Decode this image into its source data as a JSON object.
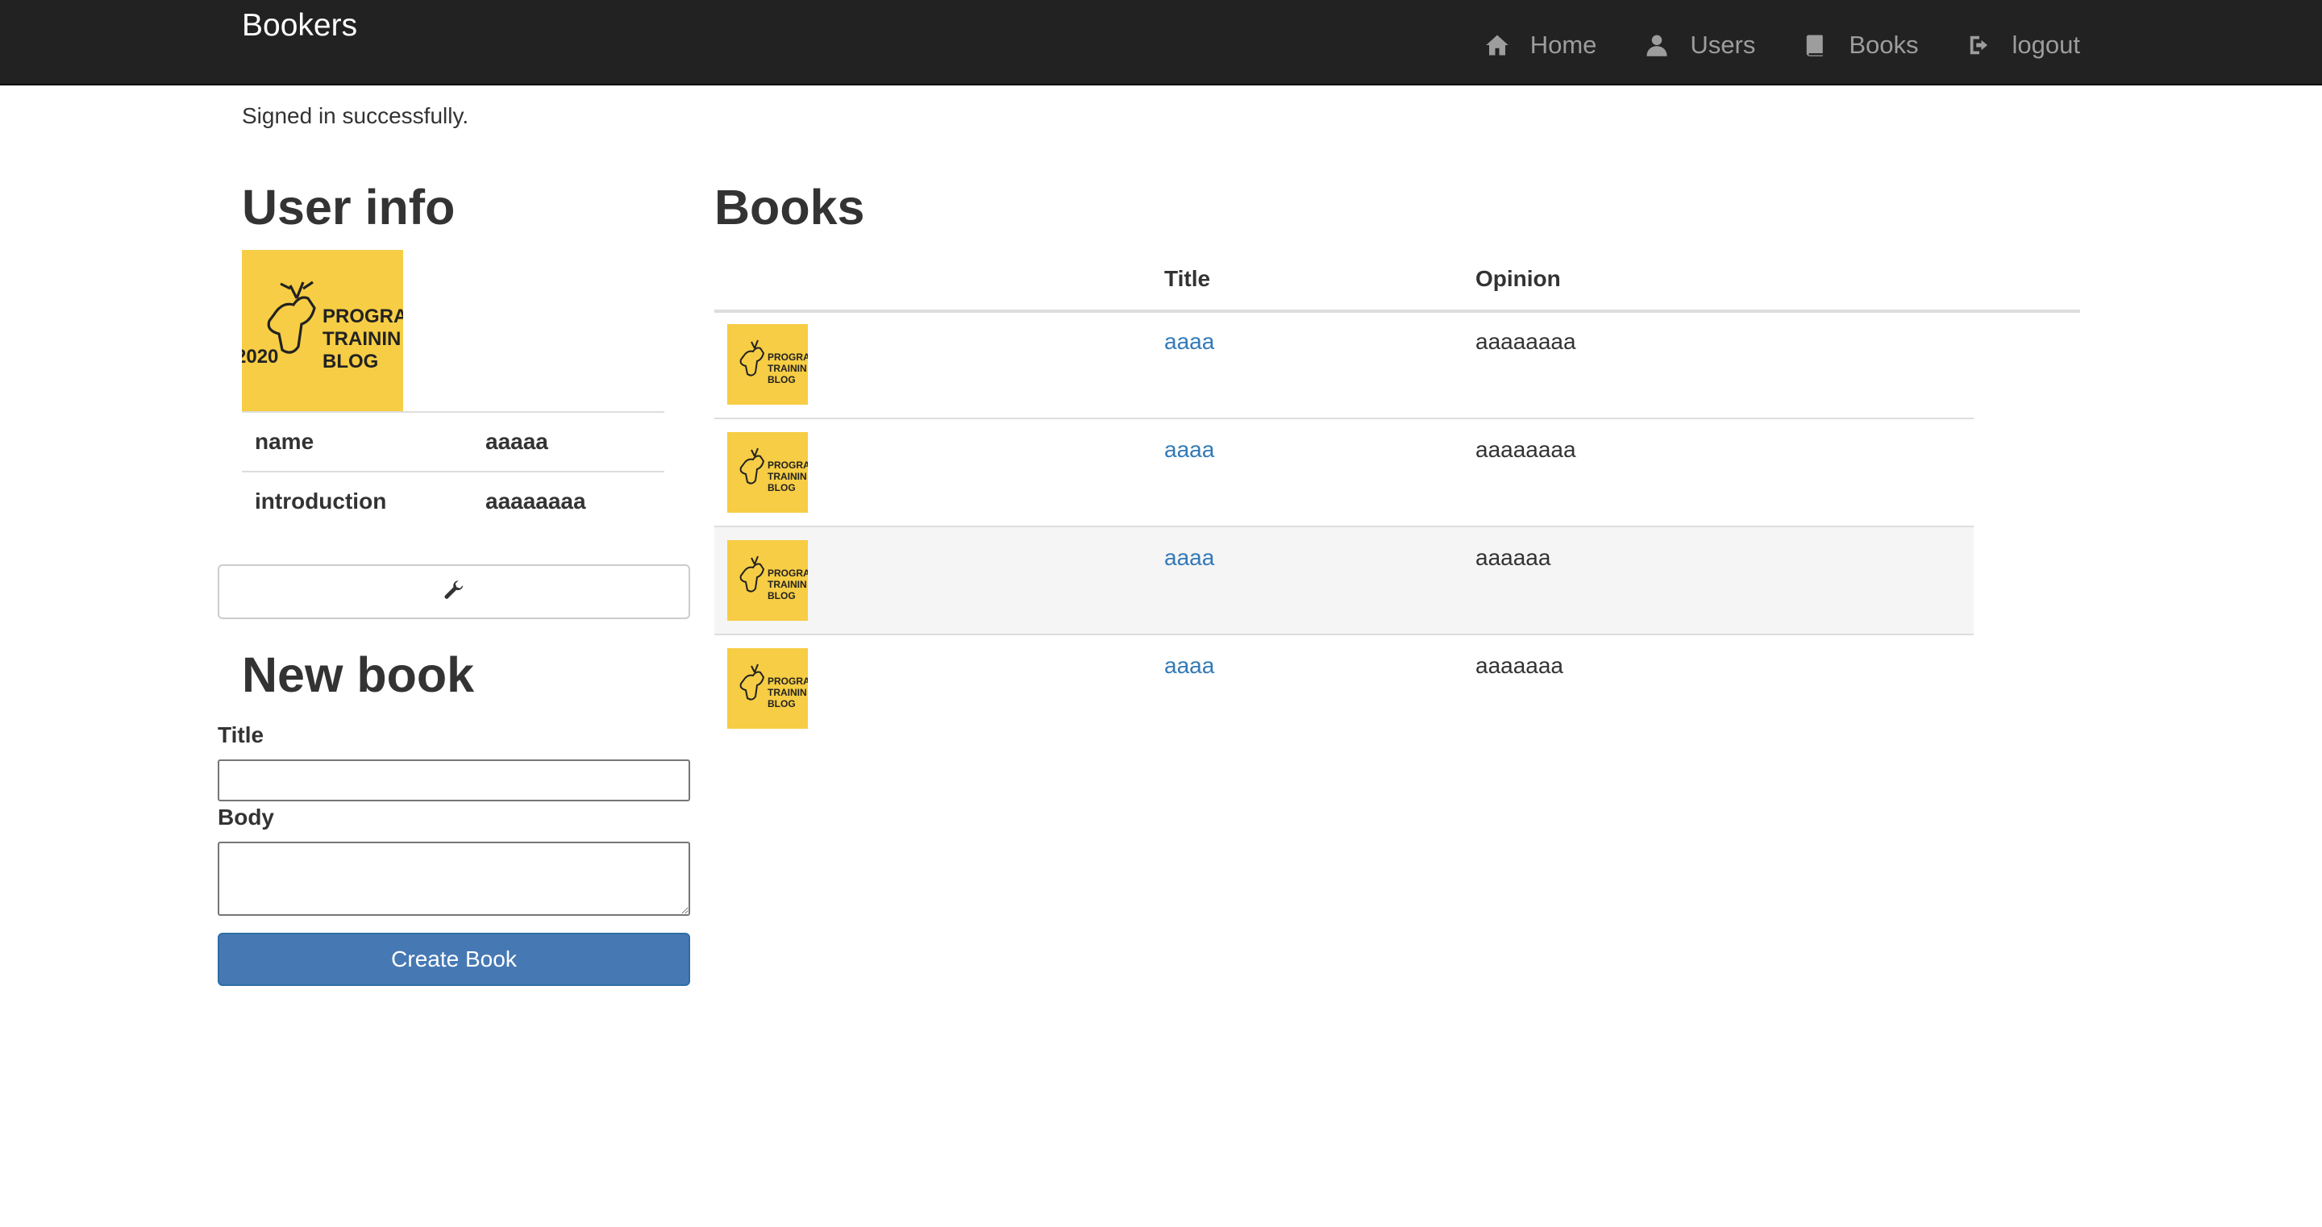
{
  "nav": {
    "brand": "Bookers",
    "links": [
      {
        "label": "Home",
        "icon": "home-icon"
      },
      {
        "label": "Users",
        "icon": "user-icon"
      },
      {
        "label": "Books",
        "icon": "book-icon"
      },
      {
        "label": "logout",
        "icon": "logout-icon"
      }
    ]
  },
  "flash": "Signed in successfully.",
  "user_info": {
    "heading": "User info",
    "logo_text": [
      "PROGRA",
      "TRAININ",
      "BLOG",
      "2020"
    ],
    "rows": [
      {
        "key": "name",
        "value": "aaaaa"
      },
      {
        "key": "introduction",
        "value": "aaaaaaaa"
      }
    ],
    "edit_icon": "wrench-icon"
  },
  "new_book": {
    "heading": "New book",
    "title_label": "Title",
    "body_label": "Body",
    "title_value": "",
    "body_value": "",
    "submit_label": "Create Book"
  },
  "books": {
    "heading": "Books",
    "columns": [
      "",
      "Title",
      "Opinion"
    ],
    "rows": [
      {
        "title": "aaaa",
        "opinion": "aaaaaaaa"
      },
      {
        "title": "aaaa",
        "opinion": "aaaaaaaa"
      },
      {
        "title": "aaaa",
        "opinion": "aaaaaa"
      },
      {
        "title": "aaaa",
        "opinion": "aaaaaaa"
      }
    ]
  },
  "colors": {
    "navbar": "#222222",
    "link": "#337ab7",
    "primary_button": "#4679b4",
    "logo_bg": "#f6cd44"
  }
}
